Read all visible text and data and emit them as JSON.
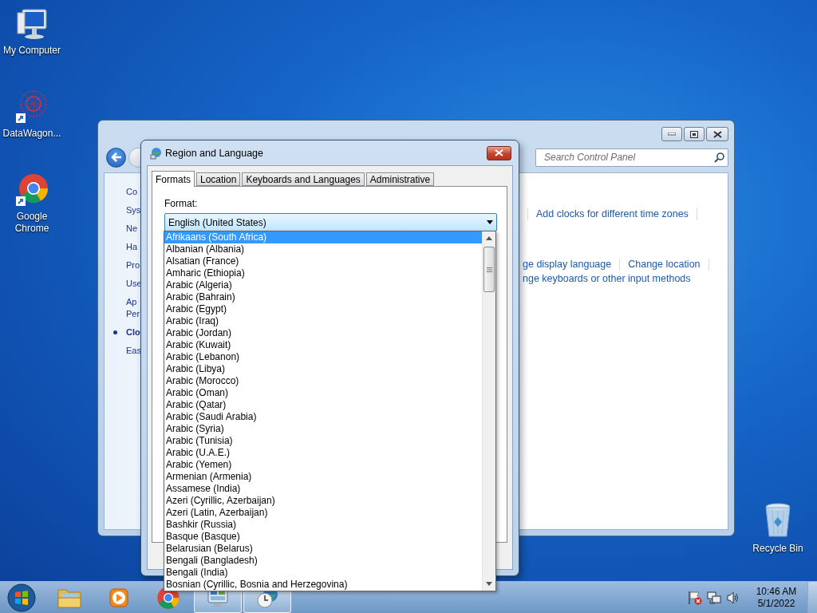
{
  "desktop_icons": [
    {
      "kind": "computer",
      "label": "My Computer"
    },
    {
      "kind": "app",
      "label": "DataWagon..."
    },
    {
      "kind": "chrome",
      "label": "Google Chrome"
    },
    {
      "kind": "recycle",
      "label": "Recycle Bin"
    }
  ],
  "control_panel": {
    "search": {
      "placeholder": "Search Control Panel"
    },
    "nav_items": [
      {
        "lines": [
          "Co"
        ],
        "selected": false
      },
      {
        "lines": [
          "Sys"
        ],
        "selected": false
      },
      {
        "lines": [
          "Ne"
        ],
        "selected": false
      },
      {
        "lines": [
          "Ha"
        ],
        "selected": false
      },
      {
        "lines": [
          "Pro"
        ],
        "selected": false
      },
      {
        "lines": [
          "Use"
        ],
        "selected": false
      },
      {
        "lines": [
          "Ap",
          "Per"
        ],
        "selected": false
      },
      {
        "lines": [
          "Clo"
        ],
        "selected": true
      },
      {
        "lines": [
          "Eas"
        ],
        "selected": false
      }
    ],
    "link_rows": [
      {
        "links": [
          "Add clocks for different time zones"
        ]
      },
      {
        "links": [
          "ge display language",
          "Change location"
        ]
      },
      {
        "links": [
          "nge keyboards or other input methods"
        ]
      }
    ]
  },
  "dialog": {
    "title": "Region and Language",
    "tabs": [
      {
        "label": "Formats",
        "selected": true
      },
      {
        "label": "Location",
        "selected": false
      },
      {
        "label": "Keyboards and Languages",
        "selected": false
      },
      {
        "label": "Administrative",
        "selected": false
      }
    ],
    "format": {
      "label": "Format:",
      "value": "English (United States)",
      "expanded": true,
      "options": [
        {
          "label": "Afrikaans (South Africa)",
          "selected": true
        },
        {
          "label": "Albanian (Albania)",
          "selected": false
        },
        {
          "label": "Alsatian (France)",
          "selected": false
        },
        {
          "label": "Amharic (Ethiopia)",
          "selected": false
        },
        {
          "label": "Arabic (Algeria)",
          "selected": false
        },
        {
          "label": "Arabic (Bahrain)",
          "selected": false
        },
        {
          "label": "Arabic (Egypt)",
          "selected": false
        },
        {
          "label": "Arabic (Iraq)",
          "selected": false
        },
        {
          "label": "Arabic (Jordan)",
          "selected": false
        },
        {
          "label": "Arabic (Kuwait)",
          "selected": false
        },
        {
          "label": "Arabic (Lebanon)",
          "selected": false
        },
        {
          "label": "Arabic (Libya)",
          "selected": false
        },
        {
          "label": "Arabic (Morocco)",
          "selected": false
        },
        {
          "label": "Arabic (Oman)",
          "selected": false
        },
        {
          "label": "Arabic (Qatar)",
          "selected": false
        },
        {
          "label": "Arabic (Saudi Arabia)",
          "selected": false
        },
        {
          "label": "Arabic (Syria)",
          "selected": false
        },
        {
          "label": "Arabic (Tunisia)",
          "selected": false
        },
        {
          "label": "Arabic (U.A.E.)",
          "selected": false
        },
        {
          "label": "Arabic (Yemen)",
          "selected": false
        },
        {
          "label": "Armenian (Armenia)",
          "selected": false
        },
        {
          "label": "Assamese (India)",
          "selected": false
        },
        {
          "label": "Azeri (Cyrillic, Azerbaijan)",
          "selected": false
        },
        {
          "label": "Azeri (Latin, Azerbaijan)",
          "selected": false
        },
        {
          "label": "Bashkir (Russia)",
          "selected": false
        },
        {
          "label": "Basque (Basque)",
          "selected": false
        },
        {
          "label": "Belarusian (Belarus)",
          "selected": false
        },
        {
          "label": "Bengali (Bangladesh)",
          "selected": false
        },
        {
          "label": "Bengali (India)",
          "selected": false
        },
        {
          "label": "Bosnian (Cyrillic, Bosnia and Herzegovina)",
          "selected": false
        }
      ]
    }
  },
  "taskbar": {
    "items": [
      {
        "kind": "explorer",
        "active": false
      },
      {
        "kind": "media",
        "active": false
      },
      {
        "kind": "chrome",
        "active": false
      },
      {
        "kind": "control_panel",
        "active": true
      },
      {
        "kind": "clock",
        "active": true
      }
    ],
    "tray_icons": [
      {
        "kind": "flag"
      },
      {
        "kind": "network"
      },
      {
        "kind": "speaker"
      }
    ],
    "time": "10:46 AM",
    "date": "5/1/2022"
  }
}
